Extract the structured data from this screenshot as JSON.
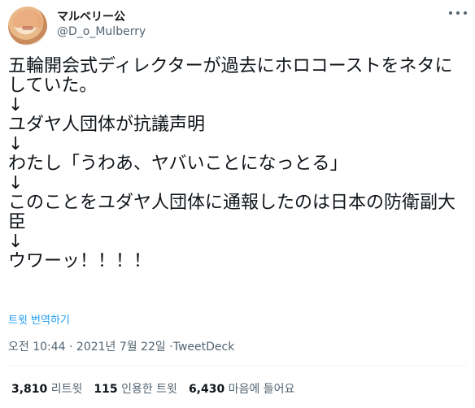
{
  "user": {
    "display_name": "マルベリー公",
    "handle": "@D_o_Mulberry",
    "avatar_icon": "avatar-illustration-icon"
  },
  "tweet": {
    "lines": [
      "五輪開会式ディレクターが過去にホロコーストをネタにしていた。",
      "↓",
      "ユダヤ人団体が抗議声明",
      "↓",
      "わたし「うわあ、ヤバいことになっとる」",
      "↓",
      "このことをユダヤ人団体に通報したのは日本の防衛副大臣",
      "↓",
      "ウワーッ！！！！"
    ],
    "translate_label": "트윗 번역하기"
  },
  "meta": {
    "time": "오전 10:44",
    "separator": "·",
    "date": "2021년 7월 22일",
    "source": "TweetDeck"
  },
  "stats": {
    "retweets_count": "3,810",
    "retweets_label": "리트윗",
    "quotes_count": "115",
    "quotes_label": "인용한 트윗",
    "likes_count": "6,430",
    "likes_label": "마음에 들어요"
  },
  "colors": {
    "text": "#0f1419",
    "secondary": "#536471",
    "link": "#1d9bf0",
    "divider": "#eff3f4"
  }
}
